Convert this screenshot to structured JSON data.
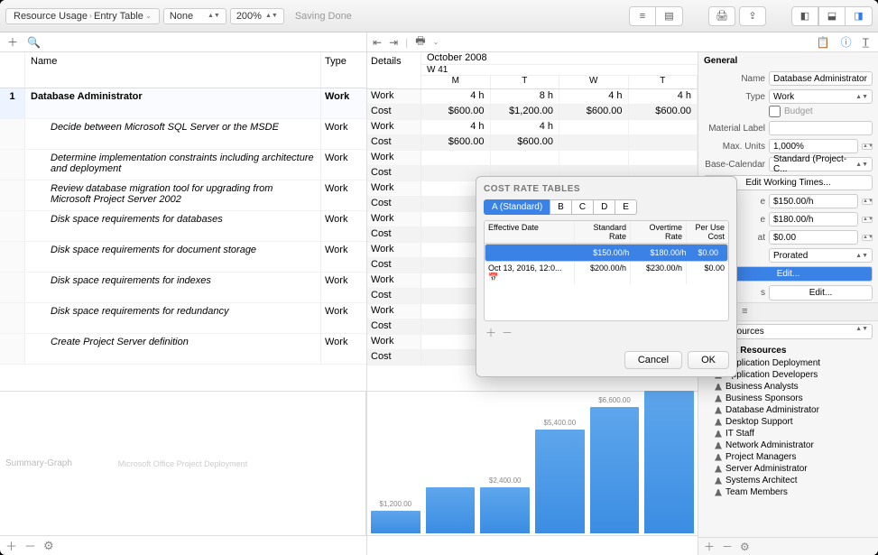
{
  "toolbar": {
    "breadcrumb1": "Resource Usage",
    "breadcrumb2": "Entry Table",
    "filter": "None",
    "zoom": "200%",
    "status": "Saving Done"
  },
  "left_header": {
    "name": "Name",
    "type": "Type"
  },
  "main_resource": {
    "id": "1",
    "name": "Database Administrator",
    "type": "Work"
  },
  "tasks": [
    {
      "name": "Decide between Microsoft SQL Server or the MSDE",
      "type": "Work"
    },
    {
      "name": "Determine implementation constraints including architecture and deployment",
      "type": "Work"
    },
    {
      "name": "Review database migration tool for upgrading from Microsoft Project Server 2002",
      "type": "Work"
    },
    {
      "name": "Disk space requirements for databases",
      "type": "Work"
    },
    {
      "name": "Disk space requirements for document storage",
      "type": "Work"
    },
    {
      "name": "Disk space requirements for indexes",
      "type": "Work"
    },
    {
      "name": "Disk space requirements for redundancy",
      "type": "Work"
    },
    {
      "name": "Create Project Server  definition",
      "type": "Work"
    }
  ],
  "details_label": "Details",
  "work_label": "Work",
  "cost_label": "Cost",
  "calendar": {
    "month": "October 2008",
    "week": "W 41",
    "days": [
      "M",
      "T",
      "W",
      "T"
    ]
  },
  "summary_row": {
    "work": [
      "4 h",
      "8 h",
      "4 h",
      "4 h"
    ],
    "cost": [
      "$600.00",
      "$1,200.00",
      "$600.00",
      "$600.00"
    ]
  },
  "task_details": [
    {
      "work": [
        "4 h",
        "4 h",
        "",
        ""
      ],
      "cost": [
        "$600.00",
        "$600.00",
        "",
        ""
      ]
    },
    {
      "work": [
        "",
        "",
        "",
        ""
      ],
      "cost": [
        "",
        "",
        "",
        ""
      ]
    },
    {
      "work": [
        "",
        "",
        "",
        ""
      ],
      "cost": [
        "",
        "",
        "",
        ""
      ]
    },
    {
      "work": [
        "",
        "",
        "",
        ""
      ],
      "cost": [
        "",
        "",
        "",
        ""
      ]
    },
    {
      "work": [
        "",
        "",
        "",
        ""
      ],
      "cost": [
        "",
        "",
        "",
        ""
      ]
    },
    {
      "work": [
        "",
        "",
        "",
        ""
      ],
      "cost": [
        "",
        "",
        "",
        ""
      ]
    },
    {
      "work": [
        "",
        "",
        "",
        ""
      ],
      "cost": [
        "",
        "",
        "",
        ""
      ]
    },
    {
      "work": [
        "",
        "",
        "",
        ""
      ],
      "cost": [
        "",
        "",
        "",
        ""
      ]
    }
  ],
  "chart_data": {
    "type": "bar",
    "title": "Summary-Graph",
    "subtitle": "Microsoft Office Project  Deployment",
    "categories": [
      "",
      "",
      "",
      "",
      ""
    ],
    "values": [
      1200,
      2400,
      2400,
      5400,
      6600
    ],
    "labels": [
      "$1,200.00",
      "",
      "$2,400.00",
      "$5,400.00",
      "$6,600.00"
    ]
  },
  "inspector": {
    "section_general": "General",
    "name_lbl": "Name",
    "name_val": "Database Administrator",
    "type_lbl": "Type",
    "type_val": "Work",
    "budget_lbl": "Budget",
    "matlabel_lbl": "Material Label",
    "matlabel_val": "",
    "maxunits_lbl": "Max. Units",
    "maxunits_val": "1,000%",
    "basecal_lbl": "Base-Calendar",
    "basecal_val": "Standard (Project-C...",
    "edit_working": "Edit Working Times...",
    "rate_e": "$150.00/h",
    "rate_e2": "$180.00/h",
    "rate_at": "$0.00",
    "prorated": "Prorated",
    "edit1": "Edit...",
    "edit2": "Edit...",
    "s_label": "s",
    "all_resources": "All Resources",
    "wr_header": "Work Resources",
    "resources": [
      "Application Deployment",
      "Application Developers",
      "Business Analysts",
      "Business Sponsors",
      "Database Administrator",
      "Desktop Support",
      "IT Staff",
      "Network Administrator",
      "Project Managers",
      "Server Administrator",
      "Systems Architect",
      "Team Members"
    ]
  },
  "popover": {
    "title": "COST RATE TABLES",
    "tabs": [
      "A (Standard)",
      "B",
      "C",
      "D",
      "E"
    ],
    "columns": [
      "Effective Date",
      "Standard Rate",
      "Overtime Rate",
      "Per Use Cost"
    ],
    "row_sel": {
      "date": "",
      "std": "$150.00/h",
      "ovt": "$180.00/h",
      "use": "$0.00"
    },
    "row2": {
      "date": "Oct 13, 2016, 12:0...",
      "std": "$200.00/h",
      "ovt": "$230.00/h",
      "use": "$0.00"
    },
    "cancel": "Cancel",
    "ok": "OK"
  }
}
